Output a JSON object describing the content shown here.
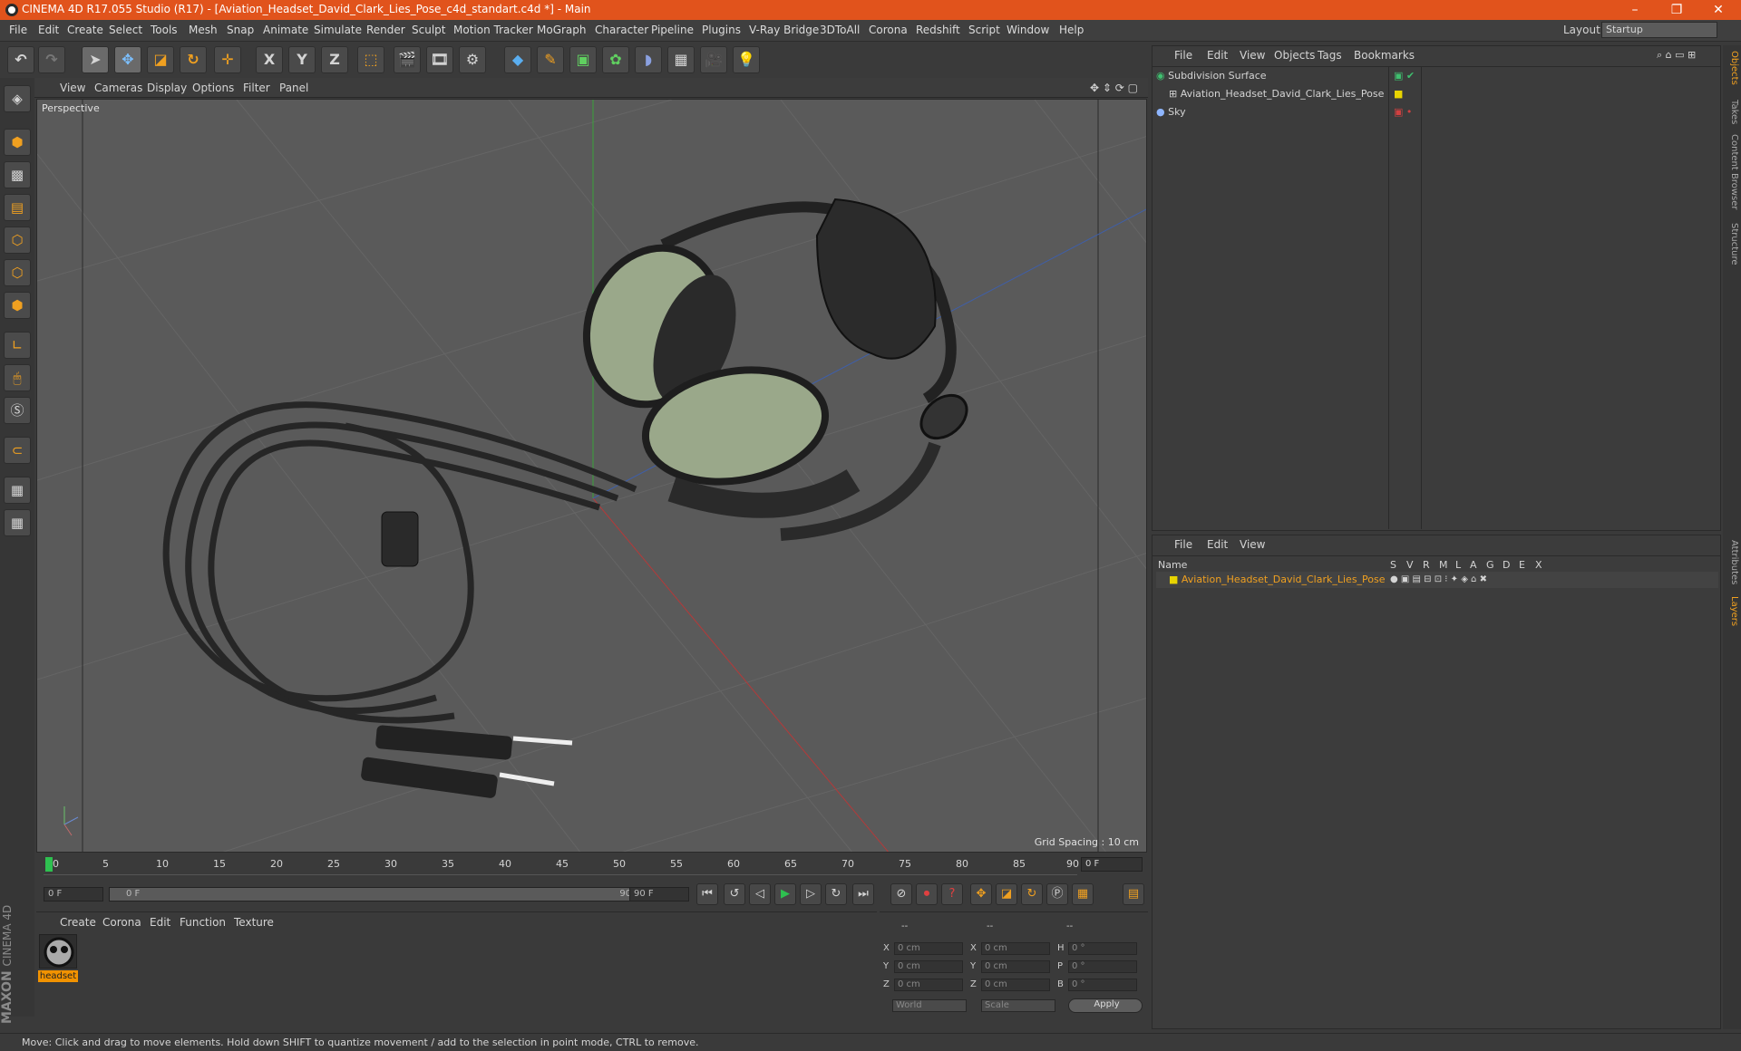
{
  "window": {
    "title": "CINEMA 4D R17.055 Studio (R17) - [Aviation_Headset_David_Clark_Lies_Pose_c4d_standart.c4d *] - Main",
    "controls": [
      "–",
      "❐",
      "✕"
    ]
  },
  "menu": [
    "File",
    "Edit",
    "Create",
    "Select",
    "Tools",
    "Mesh",
    "Snap",
    "Animate",
    "Simulate",
    "Render",
    "Sculpt",
    "Motion Tracker",
    "MoGraph",
    "Character",
    "Pipeline",
    "Plugins",
    "V-Ray Bridge",
    "3DToAll",
    "Corona",
    "Redshift",
    "Script",
    "Window",
    "Help"
  ],
  "layout": {
    "label": "Layout:",
    "value": "Startup"
  },
  "toolbar": {
    "axis_x": "X",
    "axis_y": "Y",
    "axis_z": "Z"
  },
  "viewport": {
    "menu": [
      "View",
      "Cameras",
      "Display",
      "Options",
      "Filter",
      "Panel"
    ],
    "camera": "Perspective",
    "grid_spacing": "Grid Spacing : 10 cm"
  },
  "timeline": {
    "ticks": [
      "0",
      "5",
      "10",
      "15",
      "20",
      "25",
      "30",
      "35",
      "40",
      "45",
      "50",
      "55",
      "60",
      "65",
      "70",
      "75",
      "80",
      "85",
      "90"
    ],
    "current": "0 F"
  },
  "transport": {
    "start": "0 F",
    "range_start": "0 F",
    "range_end": "90 F",
    "end": "90 F"
  },
  "material_manager": {
    "menu": [
      "Create",
      "Corona",
      "Edit",
      "Function",
      "Texture"
    ],
    "material_name": "headset"
  },
  "coordinates": {
    "header": [
      "--",
      "--",
      "--"
    ],
    "rows": [
      {
        "a": "X",
        "av": "0 cm",
        "b": "X",
        "bv": "0 cm",
        "c": "H",
        "cv": "0 °"
      },
      {
        "a": "Y",
        "av": "0 cm",
        "b": "Y",
        "bv": "0 cm",
        "c": "P",
        "cv": "0 °"
      },
      {
        "a": "Z",
        "av": "0 cm",
        "b": "Z",
        "bv": "0 cm",
        "c": "B",
        "cv": "0 °"
      }
    ],
    "world": "World",
    "scale": "Scale",
    "apply": "Apply"
  },
  "object_manager": {
    "menu": [
      "File",
      "Edit",
      "View",
      "Objects",
      "Tags",
      "Bookmarks"
    ],
    "objects": [
      "Subdivision Surface",
      "Aviation_Headset_David_Clark_Lies_Pose",
      "Sky"
    ]
  },
  "layer_manager": {
    "menu": [
      "File",
      "Edit",
      "View"
    ],
    "columns": [
      "Name",
      "S",
      "V",
      "R",
      "M",
      "L",
      "A",
      "G",
      "D",
      "E",
      "X"
    ],
    "layer": "Aviation_Headset_David_Clark_Lies_Pose"
  },
  "right_tabs": [
    "Objects",
    "Takes",
    "Content Browser",
    "Structure",
    "Attributes",
    "Layers"
  ],
  "status": "Move: Click and drag to move elements. Hold down SHIFT to quantize movement / add to the selection in point mode, CTRL to remove.",
  "brand": {
    "maxon": "MAXON",
    "product": "CINEMA 4D"
  }
}
